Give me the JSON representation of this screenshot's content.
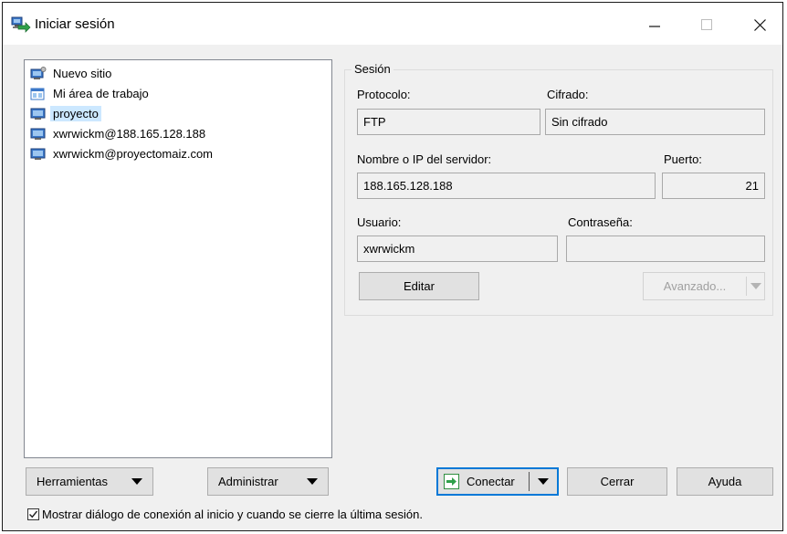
{
  "window": {
    "title": "Iniciar sesión",
    "controls": [
      "minimize-icon",
      "maximize-icon",
      "close-icon"
    ]
  },
  "tree": {
    "items": [
      {
        "label": "Nuevo sitio",
        "icon": "new-site-icon",
        "selected": false
      },
      {
        "label": "Mi área de trabajo",
        "icon": "workspace-icon",
        "selected": false
      },
      {
        "label": "proyecto",
        "icon": "monitor-icon",
        "selected": true
      },
      {
        "label": "xwrwickm@188.165.128.188",
        "icon": "monitor-icon",
        "selected": false
      },
      {
        "label": "xwrwickm@proyectomaiz.com",
        "icon": "monitor-icon",
        "selected": false
      }
    ]
  },
  "session": {
    "group_label": "Sesión",
    "protocol_label": "Protocolo:",
    "protocol_value": "FTP",
    "encryption_label": "Cifrado:",
    "encryption_value": "Sin cifrado",
    "host_label": "Nombre o IP del servidor:",
    "host_value": "188.165.128.188",
    "port_label": "Puerto:",
    "port_value": "21",
    "user_label": "Usuario:",
    "user_value": "xwrwickm",
    "password_label": "Contraseña:",
    "password_value": "",
    "edit_button": "Editar",
    "advanced_button": "Avanzado..."
  },
  "footer": {
    "tools_button": "Herramientas",
    "manage_button": "Administrar",
    "connect_button": "Conectar",
    "close_button": "Cerrar",
    "help_button": "Ayuda",
    "show_dialog_checkbox": "Mostrar diálogo de conexión al inicio y cuando se cierre la última sesión.",
    "show_dialog_checked": true
  },
  "colors": {
    "selection": "#cce8ff",
    "default_button_border": "#0078d7",
    "window_bg": "#f0f0f0"
  }
}
